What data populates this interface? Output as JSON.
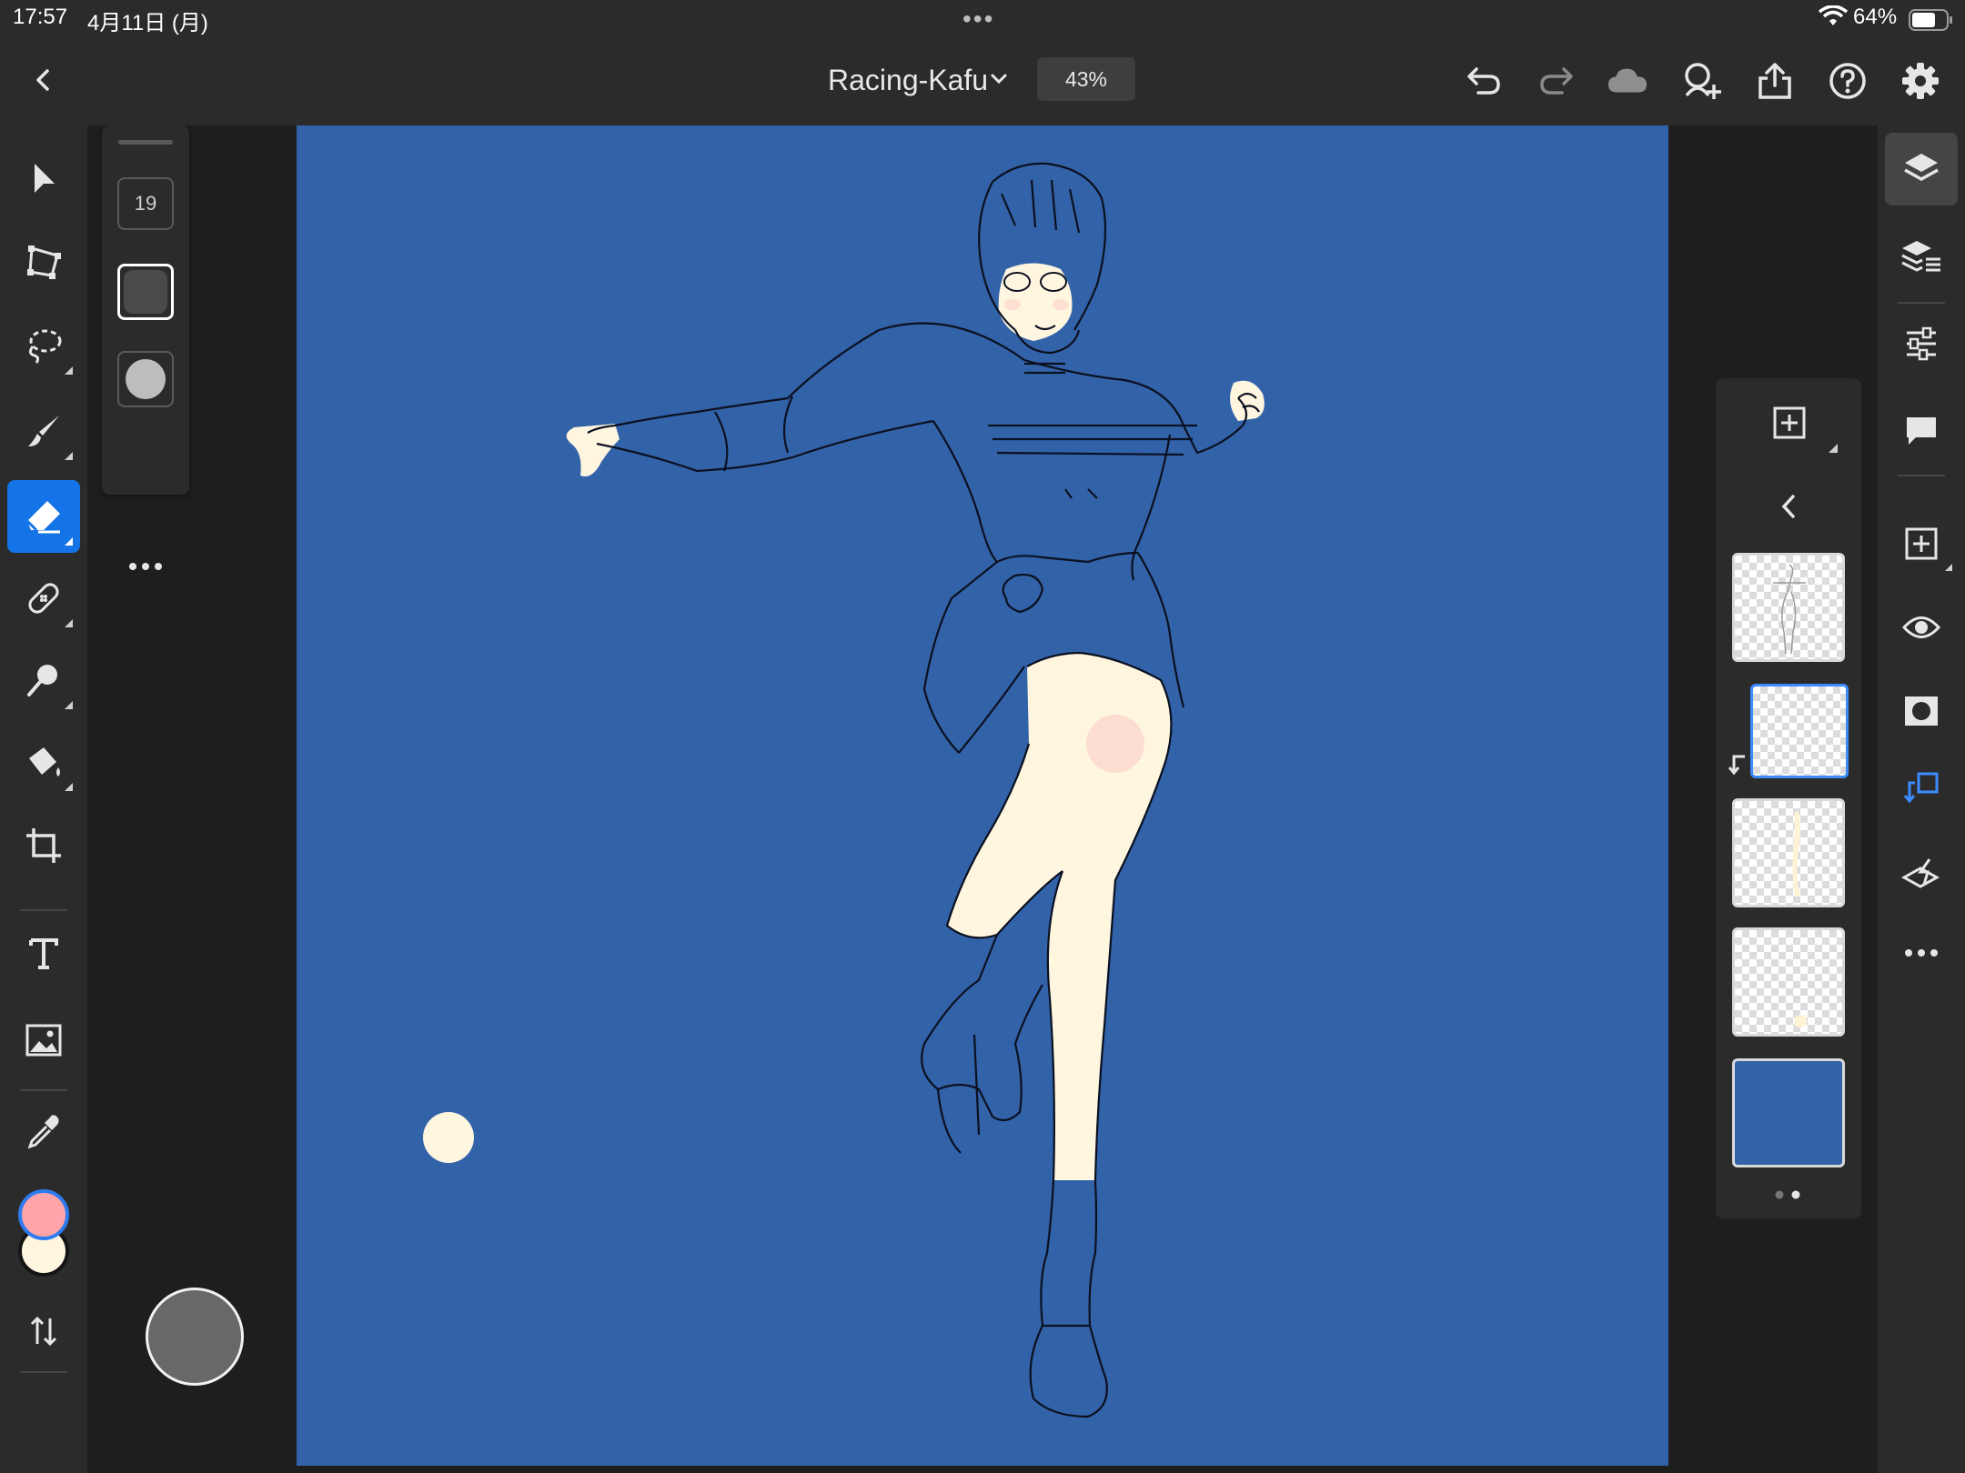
{
  "status_bar": {
    "time": "17:57",
    "date": "4月11日 (月)",
    "battery": "64%",
    "wifi_icon": "wifi-icon",
    "battery_icon": "battery-icon"
  },
  "title_bar": {
    "document_title": "Racing-Kafu",
    "zoom": "43%",
    "icons": [
      "back-icon",
      "chevron-down-icon",
      "undo-icon",
      "redo-icon",
      "cloud-icon",
      "invite-icon",
      "share-icon",
      "help-icon",
      "settings-icon"
    ]
  },
  "brush_panel": {
    "size": "19",
    "icons": [
      "square-tip-icon",
      "round-tip-icon",
      "more-icon"
    ]
  },
  "left_tools": [
    "select-icon",
    "transform-icon",
    "lasso-icon",
    "brush-icon",
    "eraser-icon",
    "healing-icon",
    "smudge-icon",
    "fill-icon",
    "crop-icon",
    "type-icon",
    "image-icon",
    "eyedropper-icon",
    "swap-colors-icon"
  ],
  "active_tool": "eraser",
  "colors": {
    "primary": "#ffa4a8",
    "secondary": "#fff6e0",
    "canvas_background": "#3262a8",
    "skin": "#fff6e0",
    "accent": "#1473e6"
  },
  "right_tools": [
    "layers-icon",
    "layer-properties-icon",
    "adjustments-icon",
    "comments-icon",
    "add-layer-icon",
    "visibility-icon",
    "mask-icon",
    "clipping-icon",
    "merge-icon",
    "more-icon"
  ],
  "layers": {
    "count": 5,
    "selected_index": 1,
    "icons": [
      "add-layer-icon",
      "collapse-icon"
    ]
  }
}
